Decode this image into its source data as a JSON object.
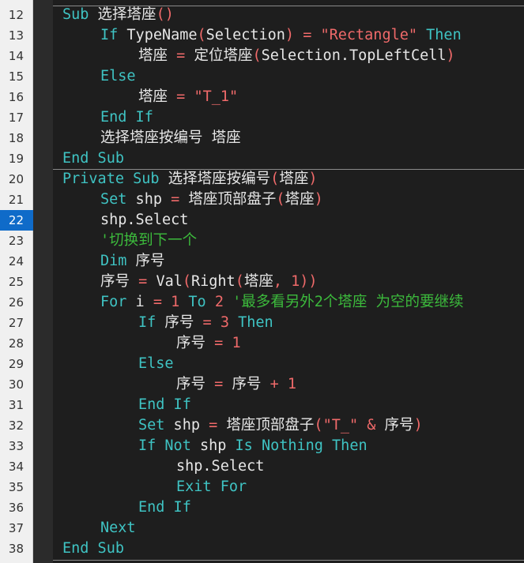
{
  "gutter": {
    "line_numbers": [
      "12",
      "13",
      "14",
      "15",
      "16",
      "17",
      "18",
      "19",
      "20",
      "21",
      "22",
      "23",
      "24",
      "25",
      "26",
      "27",
      "28",
      "29",
      "30",
      "31",
      "32",
      "33",
      "34",
      "35",
      "36",
      "37",
      "38"
    ],
    "active_line": "22"
  },
  "code": {
    "lines": [
      {
        "indent": 0,
        "tokens": [
          {
            "t": "kw",
            "v": "Sub"
          },
          {
            "t": "id",
            "v": " 选择塔座"
          },
          {
            "t": "op",
            "v": "()"
          }
        ]
      },
      {
        "indent": 1,
        "tokens": [
          {
            "t": "kw",
            "v": "If"
          },
          {
            "t": "id",
            "v": " TypeName"
          },
          {
            "t": "op",
            "v": "("
          },
          {
            "t": "id",
            "v": "Selection"
          },
          {
            "t": "op",
            "v": ")"
          },
          {
            "t": "op",
            "v": " = "
          },
          {
            "t": "str",
            "v": "\"Rectangle\""
          },
          {
            "t": "kw",
            "v": " Then"
          }
        ]
      },
      {
        "indent": 2,
        "tokens": [
          {
            "t": "id",
            "v": "塔座"
          },
          {
            "t": "op",
            "v": " = "
          },
          {
            "t": "id",
            "v": "定位塔座"
          },
          {
            "t": "op",
            "v": "("
          },
          {
            "t": "id",
            "v": "Selection.TopLeftCell"
          },
          {
            "t": "op",
            "v": ")"
          }
        ]
      },
      {
        "indent": 1,
        "tokens": [
          {
            "t": "kw",
            "v": "Else"
          }
        ]
      },
      {
        "indent": 2,
        "tokens": [
          {
            "t": "id",
            "v": "塔座"
          },
          {
            "t": "op",
            "v": " = "
          },
          {
            "t": "str",
            "v": "\"T_1\""
          }
        ]
      },
      {
        "indent": 1,
        "tokens": [
          {
            "t": "kw",
            "v": "End If"
          }
        ]
      },
      {
        "indent": 1,
        "tokens": [
          {
            "t": "id",
            "v": "选择塔座按编号 塔座"
          }
        ]
      },
      {
        "indent": 0,
        "tokens": [
          {
            "t": "kw",
            "v": "End Sub"
          }
        ]
      },
      {
        "indent": 0,
        "tokens": [
          {
            "t": "kw",
            "v": "Private Sub"
          },
          {
            "t": "id",
            "v": " 选择塔座按编号"
          },
          {
            "t": "op",
            "v": "("
          },
          {
            "t": "id",
            "v": "塔座"
          },
          {
            "t": "op",
            "v": ")"
          }
        ]
      },
      {
        "indent": 1,
        "tokens": [
          {
            "t": "kw",
            "v": "Set"
          },
          {
            "t": "id",
            "v": " shp"
          },
          {
            "t": "op",
            "v": " = "
          },
          {
            "t": "id",
            "v": "塔座顶部盘子"
          },
          {
            "t": "op",
            "v": "("
          },
          {
            "t": "id",
            "v": "塔座"
          },
          {
            "t": "op",
            "v": ")"
          }
        ]
      },
      {
        "indent": 1,
        "tokens": [
          {
            "t": "id",
            "v": "shp.Select"
          }
        ]
      },
      {
        "indent": 1,
        "tokens": [
          {
            "t": "cm",
            "v": "'切换到下一个"
          }
        ]
      },
      {
        "indent": 1,
        "tokens": [
          {
            "t": "kw",
            "v": "Dim"
          },
          {
            "t": "id",
            "v": " 序号"
          }
        ]
      },
      {
        "indent": 1,
        "tokens": [
          {
            "t": "id",
            "v": "序号"
          },
          {
            "t": "op",
            "v": " = "
          },
          {
            "t": "id",
            "v": "Val"
          },
          {
            "t": "op",
            "v": "("
          },
          {
            "t": "id",
            "v": "Right"
          },
          {
            "t": "op",
            "v": "("
          },
          {
            "t": "id",
            "v": "塔座"
          },
          {
            "t": "op",
            "v": ", "
          },
          {
            "t": "num",
            "v": "1"
          },
          {
            "t": "op",
            "v": "))"
          }
        ]
      },
      {
        "indent": 1,
        "tokens": [
          {
            "t": "kw",
            "v": "For"
          },
          {
            "t": "id",
            "v": " i"
          },
          {
            "t": "op",
            "v": " = "
          },
          {
            "t": "num",
            "v": "1"
          },
          {
            "t": "kw",
            "v": " To"
          },
          {
            "t": "num",
            "v": " 2"
          },
          {
            "t": "cm",
            "v": " '最多看另外2个塔座 为空的要继续"
          }
        ]
      },
      {
        "indent": 2,
        "tokens": [
          {
            "t": "kw",
            "v": "If"
          },
          {
            "t": "id",
            "v": " 序号"
          },
          {
            "t": "op",
            "v": " = "
          },
          {
            "t": "num",
            "v": "3"
          },
          {
            "t": "kw",
            "v": " Then"
          }
        ]
      },
      {
        "indent": 3,
        "tokens": [
          {
            "t": "id",
            "v": "序号"
          },
          {
            "t": "op",
            "v": " = "
          },
          {
            "t": "num",
            "v": "1"
          }
        ]
      },
      {
        "indent": 2,
        "tokens": [
          {
            "t": "kw",
            "v": "Else"
          }
        ]
      },
      {
        "indent": 3,
        "tokens": [
          {
            "t": "id",
            "v": "序号"
          },
          {
            "t": "op",
            "v": " = "
          },
          {
            "t": "id",
            "v": "序号"
          },
          {
            "t": "op",
            "v": " + "
          },
          {
            "t": "num",
            "v": "1"
          }
        ]
      },
      {
        "indent": 2,
        "tokens": [
          {
            "t": "kw",
            "v": "End If"
          }
        ]
      },
      {
        "indent": 2,
        "tokens": [
          {
            "t": "kw",
            "v": "Set"
          },
          {
            "t": "id",
            "v": " shp"
          },
          {
            "t": "op",
            "v": " = "
          },
          {
            "t": "id",
            "v": "塔座顶部盘子"
          },
          {
            "t": "op",
            "v": "("
          },
          {
            "t": "str",
            "v": "\"T_\""
          },
          {
            "t": "op",
            "v": " & "
          },
          {
            "t": "id",
            "v": "序号"
          },
          {
            "t": "op",
            "v": ")"
          }
        ]
      },
      {
        "indent": 2,
        "tokens": [
          {
            "t": "kw",
            "v": "If Not"
          },
          {
            "t": "id",
            "v": " shp"
          },
          {
            "t": "kw",
            "v": " Is Nothing Then"
          }
        ]
      },
      {
        "indent": 3,
        "tokens": [
          {
            "t": "id",
            "v": "shp.Select"
          }
        ]
      },
      {
        "indent": 3,
        "tokens": [
          {
            "t": "kw",
            "v": "Exit For"
          }
        ]
      },
      {
        "indent": 2,
        "tokens": [
          {
            "t": "kw",
            "v": "End If"
          }
        ]
      },
      {
        "indent": 1,
        "tokens": [
          {
            "t": "kw",
            "v": "Next"
          }
        ]
      },
      {
        "indent": 0,
        "tokens": [
          {
            "t": "kw",
            "v": "End Sub"
          }
        ]
      }
    ]
  }
}
